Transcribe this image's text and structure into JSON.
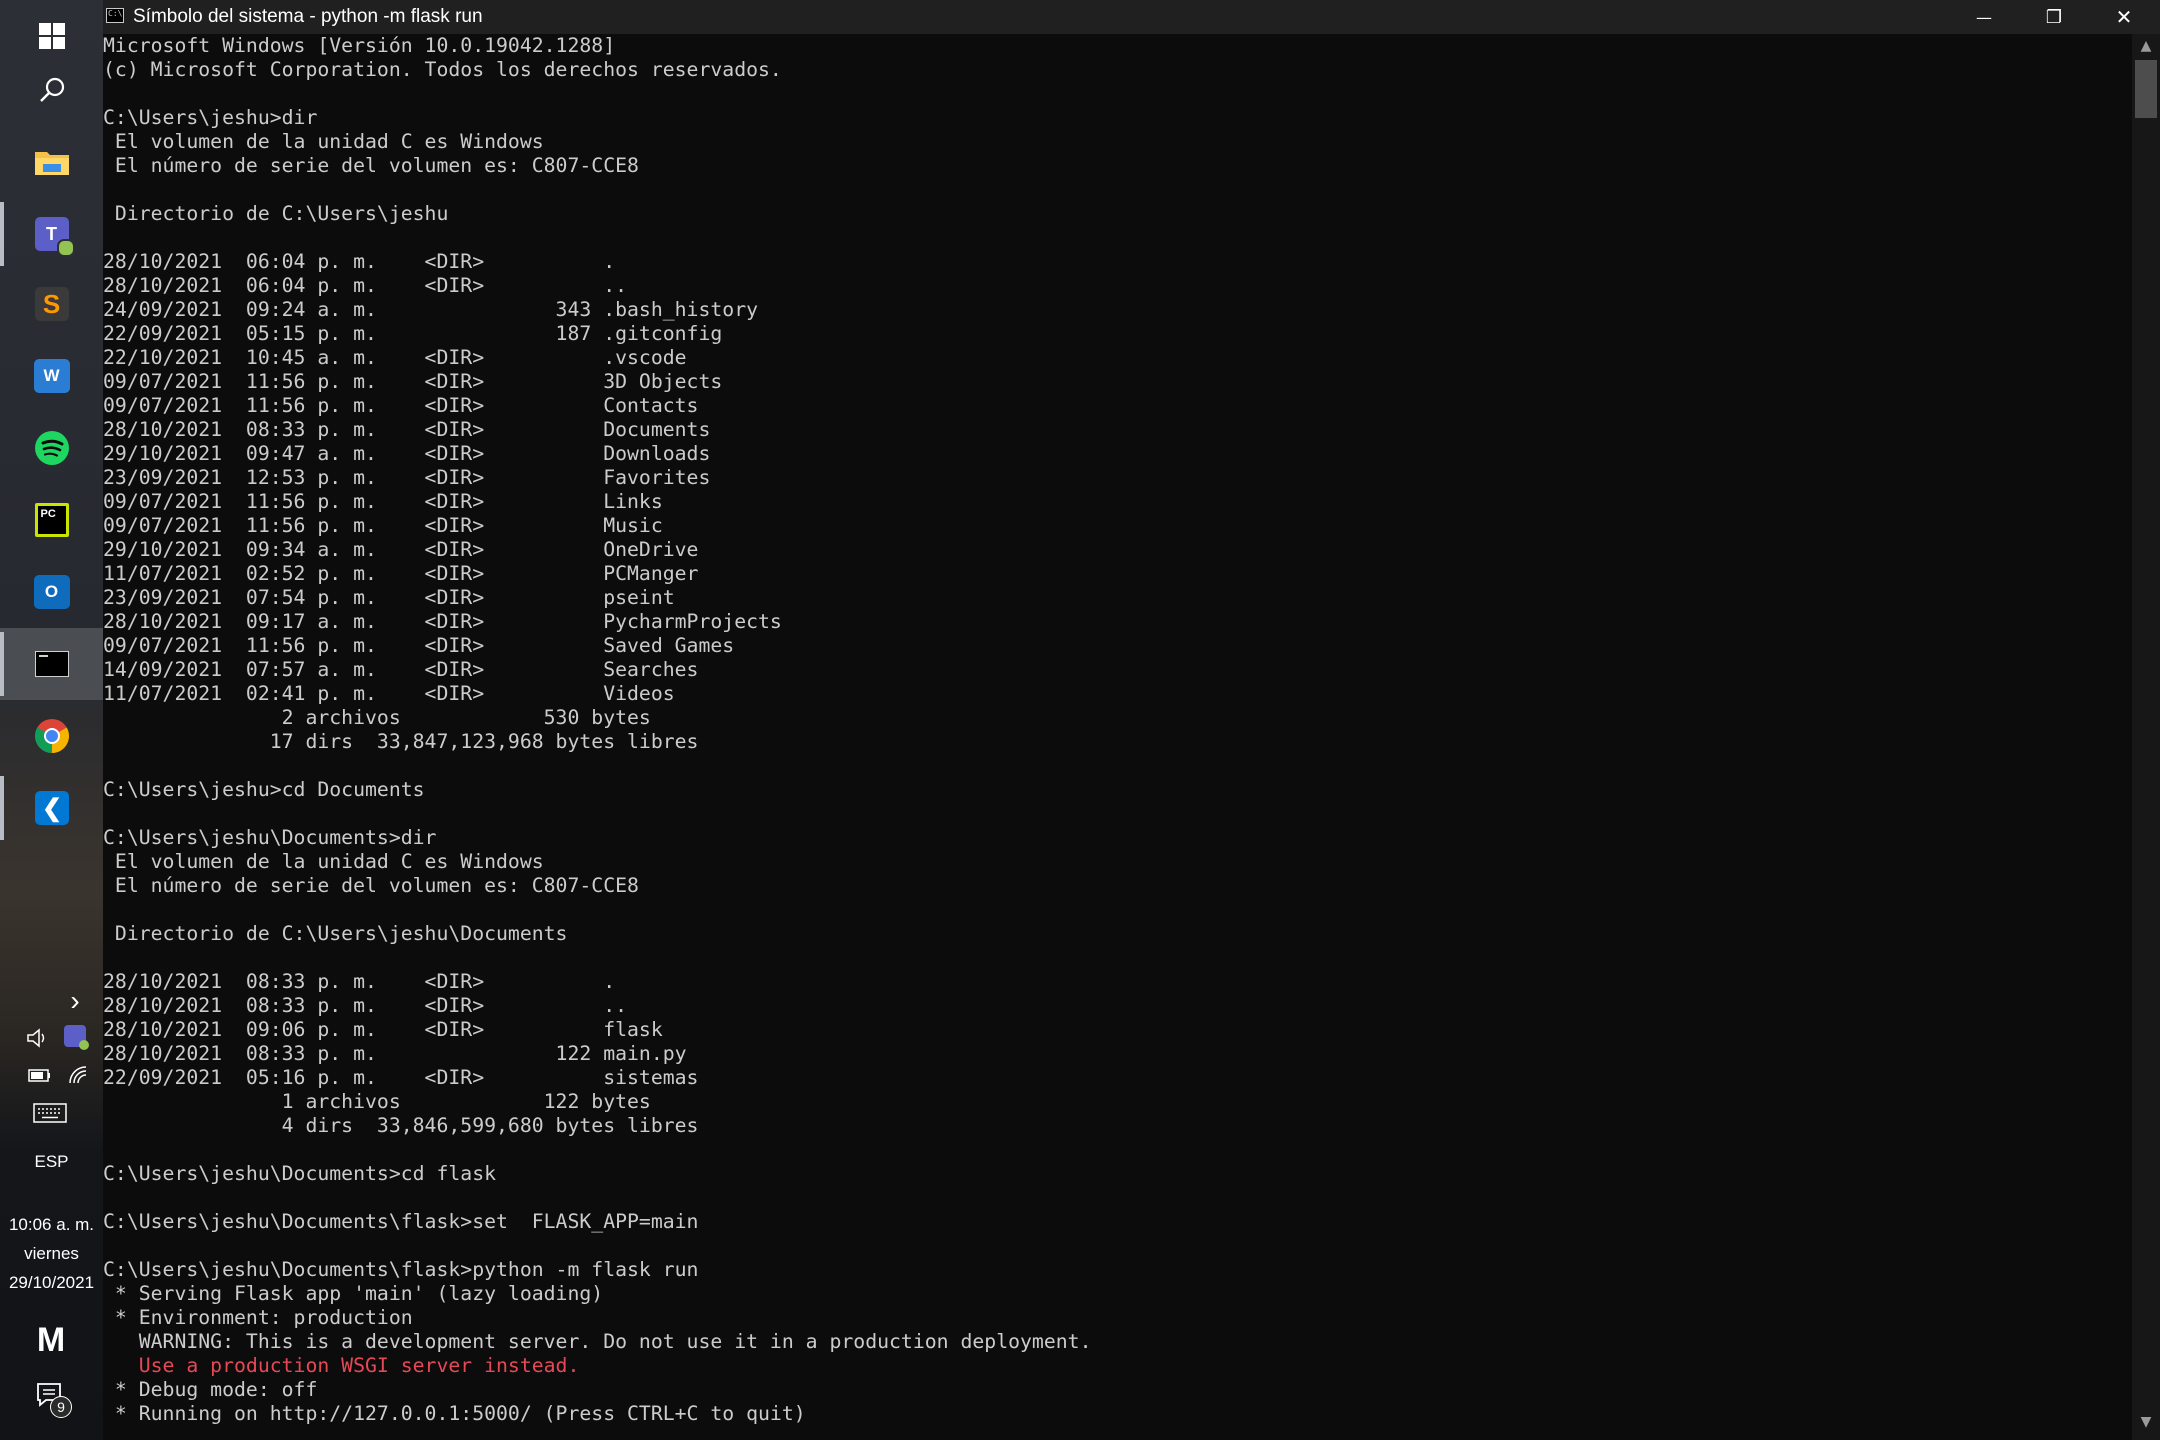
{
  "window": {
    "title": "Símbolo del sistema - python  -m flask run",
    "controls": {
      "minimize": "—",
      "restore": "❐",
      "close": "✕"
    }
  },
  "taskbar": {
    "apps": [
      {
        "name": "start",
        "icon": "windows-logo-icon"
      },
      {
        "name": "search",
        "icon": "search-icon"
      },
      {
        "name": "file-explorer",
        "icon": "folder-icon"
      },
      {
        "name": "teams",
        "icon": "teams-icon",
        "label": "T"
      },
      {
        "name": "sublime-text",
        "icon": "sublime-icon",
        "label": "S"
      },
      {
        "name": "word",
        "icon": "word-icon",
        "label": "W"
      },
      {
        "name": "spotify",
        "icon": "spotify-icon"
      },
      {
        "name": "pycharm",
        "icon": "pycharm-icon",
        "label": "PC"
      },
      {
        "name": "outlook",
        "icon": "outlook-icon",
        "label": "O"
      },
      {
        "name": "command-prompt",
        "icon": "cmd-icon"
      },
      {
        "name": "chrome",
        "icon": "chrome-icon"
      },
      {
        "name": "vscode",
        "icon": "vscode-icon",
        "label": "❯"
      }
    ],
    "tray": {
      "chevron": "›",
      "language": "ESP",
      "time": "10:06 a. m.",
      "day": "viernes",
      "date": "29/10/2021",
      "notification_count": "9",
      "brand_label": "M"
    }
  },
  "console": {
    "lines": [
      "Microsoft Windows [Versión 10.0.19042.1288]",
      "(c) Microsoft Corporation. Todos los derechos reservados.",
      "",
      "C:\\Users\\jeshu>dir",
      " El volumen de la unidad C es Windows",
      " El número de serie del volumen es: C807-CCE8",
      "",
      " Directorio de C:\\Users\\jeshu",
      "",
      "28/10/2021  06:04 p. m.    <DIR>          .",
      "28/10/2021  06:04 p. m.    <DIR>          ..",
      "24/09/2021  09:24 a. m.               343 .bash_history",
      "22/09/2021  05:15 p. m.               187 .gitconfig",
      "22/10/2021  10:45 a. m.    <DIR>          .vscode",
      "09/07/2021  11:56 p. m.    <DIR>          3D Objects",
      "09/07/2021  11:56 p. m.    <DIR>          Contacts",
      "28/10/2021  08:33 p. m.    <DIR>          Documents",
      "29/10/2021  09:47 a. m.    <DIR>          Downloads",
      "23/09/2021  12:53 p. m.    <DIR>          Favorites",
      "09/07/2021  11:56 p. m.    <DIR>          Links",
      "09/07/2021  11:56 p. m.    <DIR>          Music",
      "29/10/2021  09:34 a. m.    <DIR>          OneDrive",
      "11/07/2021  02:52 p. m.    <DIR>          PCManger",
      "23/09/2021  07:54 p. m.    <DIR>          pseint",
      "28/10/2021  09:17 a. m.    <DIR>          PycharmProjects",
      "09/07/2021  11:56 p. m.    <DIR>          Saved Games",
      "14/09/2021  07:57 a. m.    <DIR>          Searches",
      "11/07/2021  02:41 p. m.    <DIR>          Videos",
      "               2 archivos            530 bytes",
      "              17 dirs  33,847,123,968 bytes libres",
      "",
      "C:\\Users\\jeshu>cd Documents",
      "",
      "C:\\Users\\jeshu\\Documents>dir",
      " El volumen de la unidad C es Windows",
      " El número de serie del volumen es: C807-CCE8",
      "",
      " Directorio de C:\\Users\\jeshu\\Documents",
      "",
      "28/10/2021  08:33 p. m.    <DIR>          .",
      "28/10/2021  08:33 p. m.    <DIR>          ..",
      "28/10/2021  09:06 p. m.    <DIR>          flask",
      "28/10/2021  08:33 p. m.               122 main.py",
      "22/09/2021  05:16 p. m.    <DIR>          sistemas",
      "               1 archivos            122 bytes",
      "               4 dirs  33,846,599,680 bytes libres",
      "",
      "C:\\Users\\jeshu\\Documents>cd flask",
      "",
      "C:\\Users\\jeshu\\Documents\\flask>set  FLASK_APP=main",
      "",
      "C:\\Users\\jeshu\\Documents\\flask>python -m flask run",
      " * Serving Flask app 'main' (lazy loading)",
      " * Environment: production",
      "   WARNING: This is a development server. Do not use it in a production deployment.",
      "   Use a production WSGI server instead.",
      " * Debug mode: off",
      " * Running on http://127.0.0.1:5000/ (Press CTRL+C to quit)"
    ],
    "warning_line_index": 55,
    "colors": {
      "text": "#cccccc",
      "warning": "#e74856",
      "background": "#0c0c0c"
    }
  },
  "scrollbar": {
    "up_arrow": "▲",
    "down_arrow": "▼"
  }
}
